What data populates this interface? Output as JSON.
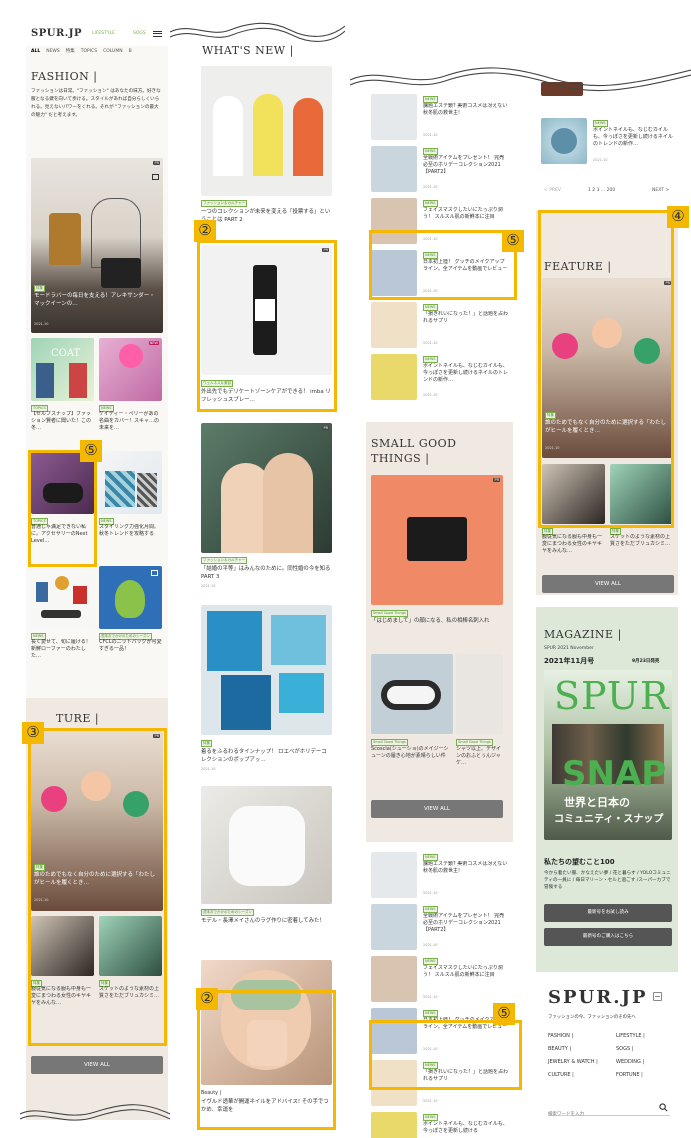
{
  "col1": {
    "logo": "SPUR.JP",
    "nav_right": [
      "LIFESTYLE",
      "SOGS"
    ],
    "tabs": [
      "ALL",
      "NEWS",
      "特集",
      "TOPICS",
      "COLUMN",
      "B"
    ],
    "section_title": "FASHION |",
    "intro": "ファッションは日常。\"ファッション\" はあなたの味方。好きな服となる鍵を向いて歩ける。スタイルがあれば自分らしくいられる。見えないパワーをくれる。それが \"ファッションの最大の魅力\" だと考えます。",
    "hero_tag": "特集",
    "hero_title": "モードラバーの毎日を支える！アレキサンダー・マックイーンの…",
    "hero_date": "2021.10",
    "cards": [
      {
        "tag": "TOPICS",
        "title": "【セルフスナップ】ファッション賢者に聞いた！この冬…",
        "date": "2021.10"
      },
      {
        "tag": "NEWS",
        "title": "ケイティー・ペリーがあの名曲をカバー！スキャ…の未来を…",
        "date": "2021.10"
      },
      {
        "tag": "TOPICS",
        "title": "普通じゃ満足できない私に。アクセサリーのNext Level…",
        "date": "2021.10"
      },
      {
        "tag": "NEWS",
        "title": "スタイリング力強化月間。秋冬トレンドを攻略する",
        "date": "2021.10"
      },
      {
        "tag": "NEWS",
        "title": "長く愛せて、旬に履ける！ 新鮮ローファーのわたした…",
        "date": "2021.10"
      },
      {
        "tag": "週末おでかけのためのシーズン",
        "title": "CFCLのニットバッグが可愛すぎる一品！",
        "date": "2021.10"
      }
    ],
    "feature_title": "TURE |",
    "feature_tag": "特集",
    "feature_caption": "誰のためでもなく自分のために選択する「わたしがヒールを履くとき…",
    "feature_date": "2021.10",
    "small_cards": [
      {
        "tag": "特集",
        "title": "服従気になる服も中身も一変にまつわる女性のキヤキヤをみんな…",
        "date": "2021.10"
      },
      {
        "tag": "特集",
        "title": "スケットのような素材の上質さをただブリュカシミ…",
        "date": "2021.10"
      }
    ],
    "view_all": "VIEW ALL",
    "label_5": "⑤",
    "label_3": "③"
  },
  "col2": {
    "section_title": "WHAT'S NEW |",
    "items": [
      {
        "tag": "ファッション＆カルチャー",
        "title": "一つのコレクションが未来を変える「投票する」ということは PART 2",
        "date": "2021.10"
      },
      {
        "tag": "ウェルネス＆美容",
        "title": "外出先でもデリケートゾーンケアができる！ imba リフレッシュスプレー…",
        "date": "2021.10"
      },
      {
        "tag": "ファッション＆カルチャー",
        "title": "「結婚の平等」はみんなのために。同性婚の今を知る PART 3",
        "date": "2021.10"
      },
      {
        "tag": "特集",
        "title": "着るをふるわるタインナップ！ ロエベがホリデーコレクションのポップアッ…",
        "date": "2021.10"
      },
      {
        "tag": "週末おでかけのためのシーズン",
        "title": "モデル・長澤メイさんのラグ作りに密着してみた！",
        "date": "2021.10"
      },
      {
        "tag": "Beauty |",
        "title": "イヴルド透華が開運ネイルをアドバイス! その手でつかめ、幸運を",
        "date": ""
      }
    ],
    "label_2a": "②",
    "label_2b": "②"
  },
  "col3": {
    "list_top": [
      {
        "title": "課題エステ鎖? 美術コスメは冴えない秋冬肌の救世主!",
        "date": "2021.10"
      },
      {
        "title": "全戦術アイテムをプレゼント！ 完売必至のホリデーコレクション2021 【PART2】",
        "date": "2021.10"
      },
      {
        "title": "フェイスマスクしたいにたっぷり潤う！ スルスル肌の新鮮本に注目",
        "date": "2021.10"
      },
      {
        "title": "日本初上陸！ グッチのメイクアップライン。全アイテムを動画でレビュー",
        "date": "2021.10"
      },
      {
        "title": "「損きれいになった！」と話題を占われるサプリ",
        "date": "2021.10"
      },
      {
        "title": "ポイントネイルも、なじむカイルも、今っぽさを更新し続けるネイルのトレンドの新作…",
        "date": "2021.10"
      }
    ],
    "small_good": "SMALL GOOD THINGS |",
    "sg_items": [
      {
        "tag": "Small Good Things",
        "title": "「はじめまして」の顔になる、私の相棒名刺入れ",
        "date": "2021.10"
      },
      {
        "tag": "Small Good Things",
        "title": "Scoscia(シューショ)のメイジーシューンの履き心地が素晴らしい件",
        "date": "2021.10"
      },
      {
        "tag": "Small Good Things",
        "title": "シャツ以上、デザインのおふとぅんジャケ…",
        "date": "2021.10"
      }
    ],
    "view_all": "VIEW ALL",
    "list_bottom": [
      {
        "title": "課題エステ鎖? 美術コスメは冴えない秋冬肌の救世主!",
        "date": "2021.10"
      },
      {
        "title": "全戦術アイテムをプレゼント！ 完売必至のホリデーコレクション2021 【PART2】",
        "date": "2021.10"
      },
      {
        "title": "フェイスマスクしたいにたっぷり潤う！ スルスル肌の新鮮本に注目",
        "date": "2021.10"
      },
      {
        "title": "日本初上陸！ グッチのメイクアップライン。全アイテムを動画でレビュー",
        "date": "2021.10"
      },
      {
        "title": "「損きれいになった！」と話題を占われるサプリ",
        "date": "2021.10"
      },
      {
        "title": "ポイントネイルも、なじむカイルも、今っぽさを更新し続ける",
        "date": ""
      }
    ],
    "label_5a": "⑤",
    "label_5b": "⑤"
  },
  "col4": {
    "top_item": {
      "title": "ポイントネイルも、なじむカイルも、今っぽさを更新し続けるネイルのトレンドの新作…",
      "date": "2021.10"
    },
    "pager": {
      "prev": "< PREV",
      "pages": "1  2  3 ... 200",
      "next": "NEXT >"
    },
    "feature_title": "FEATURE |",
    "feature_tag": "特集",
    "feature_caption": "誰のためでもなく自分のために選択する「わたしがヒールを履くとき…",
    "feature_date": "2021.10",
    "small_cards": [
      {
        "tag": "特集",
        "title": "服従気になる服も中身も一変にまつわる女性のキヤキヤをみんな…",
        "date": "2021.10"
      },
      {
        "tag": "特集",
        "title": "スケットのような素材の上質さをただブリュカシミ…",
        "date": "2021.10"
      }
    ],
    "view_all": "VIEW ALL",
    "magazine_title": "MAGAZINE |",
    "issue_line": "SPUR 2021 November",
    "issue": "2021年11月号",
    "release": "9月23日発売",
    "cover_logo": "SPUR",
    "cover_snap": "SNAP",
    "cover_line1": "世界と日本の",
    "cover_line2": "コミュニティ・スナップ",
    "mag_heading": "私たちの望むこと100",
    "mag_desc": "今から着たい服、かなえたい夢 / 花と暮らす / YOLOコミュニティの一員に / 毎日マリーン・セルと過ごす /スーパーカブで冒険する",
    "btn_latest": "最新号をお試し読み",
    "btn_buy": "最新号のご購入はこちら",
    "footer_logo": "SPUR.JP",
    "footer_tagline": "ファッションの今、ファッションのその先へ",
    "footer_links": [
      "FASHION |",
      "LIFESTYLE |",
      "BEAUTY |",
      "SOGS |",
      "JEWELRY & WATCH |",
      "WEDDING |",
      "CULTURE |",
      "FORTUNE |"
    ],
    "search_placeholder": "検索ワードを入力",
    "label_4": "④"
  }
}
